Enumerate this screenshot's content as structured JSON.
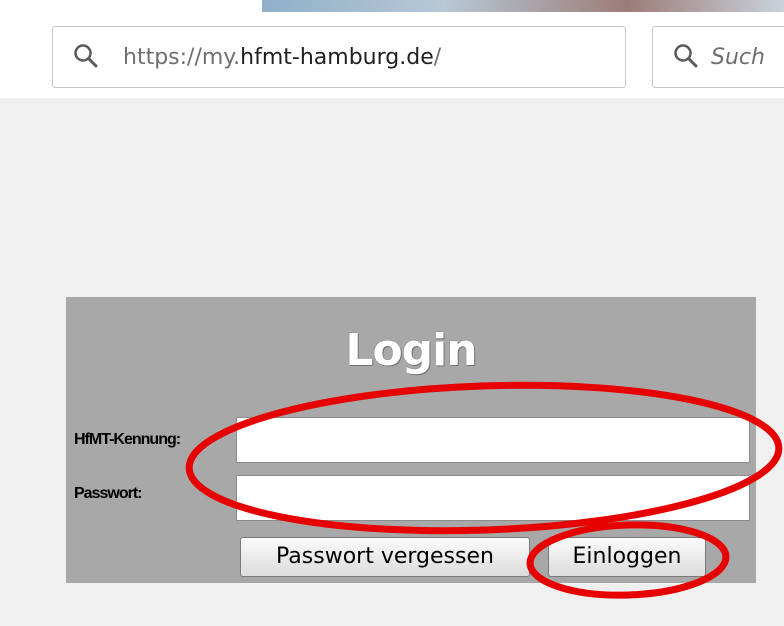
{
  "browser": {
    "url": {
      "prefix": "https://my.",
      "host": "hfmt-hamburg.de",
      "suffix": "/"
    },
    "search": {
      "placeholder": "Such"
    }
  },
  "login": {
    "title": "Login",
    "username_label": "HfMT-Kennung:",
    "username_value": "",
    "password_label": "Passwort:",
    "password_value": "",
    "forgot_button": "Passwort vergessen",
    "login_button": "Einloggen"
  },
  "icons": {
    "url_icon": "search-icon",
    "search_icon": "search-icon"
  },
  "colors": {
    "panel_background": "#a8a8a8",
    "page_background": "#f0f0f0",
    "annotation_red": "#e60000"
  }
}
